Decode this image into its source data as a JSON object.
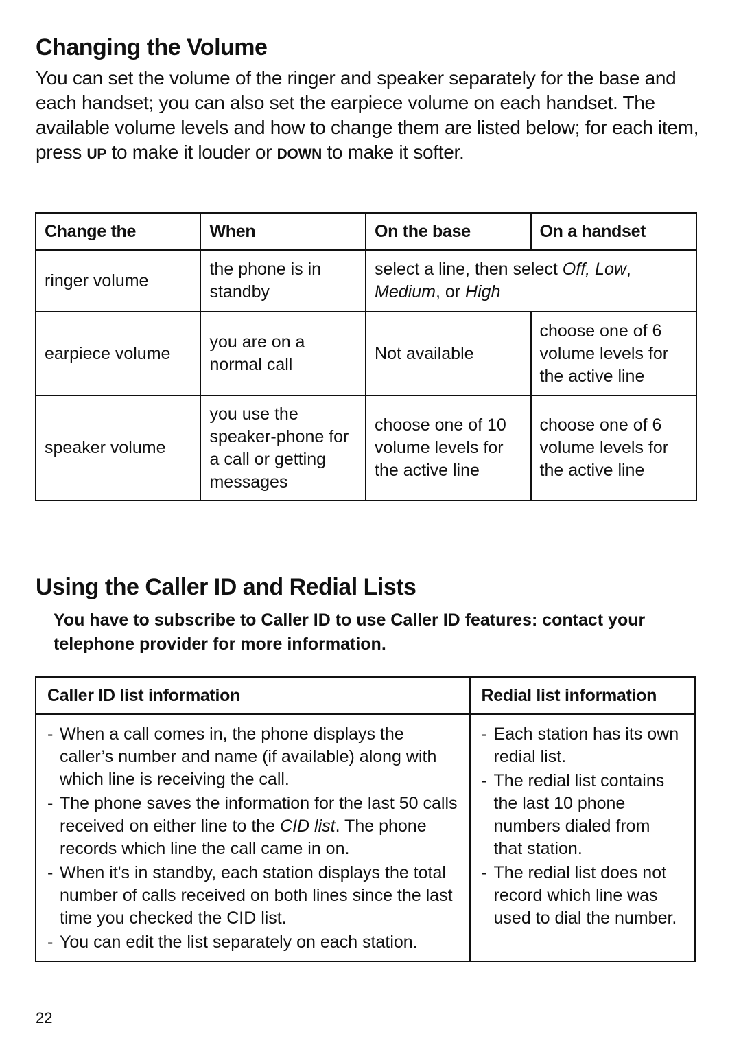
{
  "volume_section": {
    "title": "Changing the Volume",
    "intro_part1": "You can set the volume of the ringer and speaker separately for the base and each handset; you can also set the earpiece volume on each handset. The available volume levels and how to change them are listed below; for each item, press ",
    "key_up": "UP",
    "intro_part2": " to make it louder or ",
    "key_down": "DOWN",
    "intro_part3": " to make it softer.",
    "table": {
      "headers": [
        "Change the",
        "When",
        "On the base",
        "On a handset"
      ],
      "rows": [
        {
          "item": "ringer volume",
          "when": "the phone is in standby",
          "both_prefix": "select a line, then select ",
          "opt_off": "Off",
          "sep1": ", ",
          "opt_low": "Low",
          "sep2": ", ",
          "opt_medium": "Medium",
          "sep3": ", or ",
          "opt_high": "High"
        },
        {
          "item": "earpiece volume",
          "when": "you are on a normal call",
          "base": "Not available",
          "handset": "choose one of 6 volume levels for the active line"
        },
        {
          "item": "speaker volume",
          "when": "you use the speaker-phone for a call or getting messages",
          "base": "choose one of 10 volume levels for the active line",
          "handset": "choose one of 6 volume levels for the active line"
        }
      ]
    }
  },
  "caller_section": {
    "title": "Using the Caller ID and Redial Lists",
    "note": "You have to subscribe to Caller ID to use Caller ID features: contact your telephone provider for more information.",
    "table": {
      "headers": [
        "Caller ID list information",
        "Redial list information"
      ],
      "cid_items": [
        {
          "text": "When a call comes in, the phone displays the caller’s number and name (if available) along with which line is receiving the call."
        },
        {
          "pre": "The phone saves the information for the last 50 calls received on either line to the ",
          "em": "CID list",
          "post": ". The phone records which line the call came in on."
        },
        {
          "text": "When it's in standby, each station displays the total number of calls received on both lines since the last time you checked the CID list."
        },
        {
          "text": "You can edit the list separately on each station."
        }
      ],
      "redial_items": [
        "Each station has its own redial list.",
        "The redial list contains the last 10 phone numbers dialed from that station.",
        "The redial list does not record which line was used to dial the number."
      ]
    }
  },
  "page_number": "22"
}
